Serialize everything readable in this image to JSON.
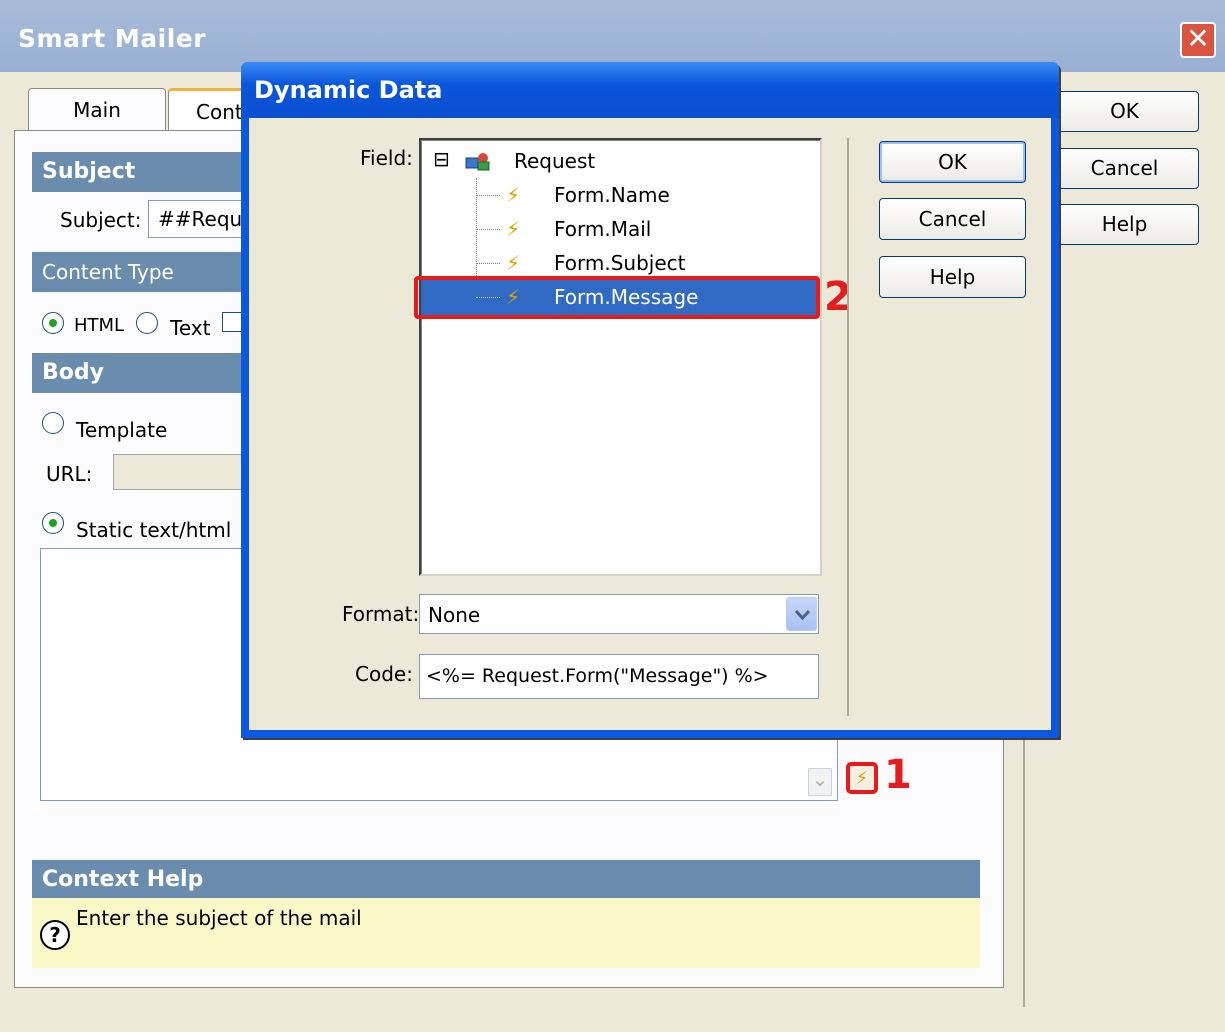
{
  "smart_mailer": {
    "title": "Smart Mailer",
    "close_glyph": "✕",
    "tabs": [
      {
        "label": "Main"
      },
      {
        "label": "Cont"
      }
    ],
    "subject_section": {
      "header": "Subject",
      "label": "Subject:",
      "value": "##Requ"
    },
    "content_type_section": {
      "header": "Content Type",
      "options": [
        {
          "label": "HTML",
          "selected": true
        },
        {
          "label": "Text",
          "selected": false
        }
      ]
    },
    "body_section": {
      "header": "Body",
      "template_label": "Template",
      "url_label": "URL:",
      "static_label": "Static text/html"
    },
    "context_help": {
      "header": "Context Help",
      "text": "Enter the subject of the mail",
      "icon_glyph": "?"
    },
    "buttons": {
      "ok": "OK",
      "cancel": "Cancel",
      "help": "Help"
    }
  },
  "dynamic_data": {
    "title": "Dynamic Data",
    "field_label": "Field:",
    "tree": {
      "root": {
        "label": "Request",
        "expander": "⊟"
      },
      "children": [
        {
          "label": "Form.Name",
          "selected": false
        },
        {
          "label": "Form.Mail",
          "selected": false
        },
        {
          "label": "Form.Subject",
          "selected": false
        },
        {
          "label": "Form.Message",
          "selected": true
        }
      ]
    },
    "format_label": "Format:",
    "format_value": "None",
    "code_label": "Code:",
    "code_value": "<%= Request.Form(\"Message\") %>",
    "buttons": {
      "ok": "OK",
      "cancel": "Cancel",
      "help": "Help"
    }
  },
  "callouts": {
    "one": "1",
    "two": "2"
  },
  "icons": {
    "bolt": "⚡",
    "dropdown": "⌄"
  },
  "colors": {
    "callout": "#e51c1c",
    "selection": "#316ac5",
    "section_header": "#6a8dae",
    "help_background": "#fbf8c8"
  }
}
